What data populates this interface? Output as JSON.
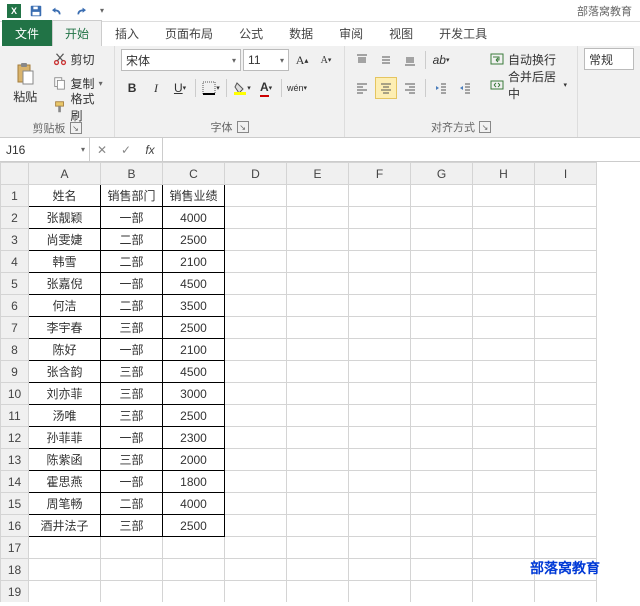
{
  "titlebar": {
    "doc_title": "部落窝教育"
  },
  "tabs": {
    "file": "文件",
    "items": [
      "开始",
      "插入",
      "页面布局",
      "公式",
      "数据",
      "审阅",
      "视图",
      "开发工具"
    ],
    "active": 0
  },
  "ribbon": {
    "clipboard": {
      "label": "剪贴板",
      "paste": "粘贴",
      "cut": "剪切",
      "copy": "复制",
      "painter": "格式刷"
    },
    "font": {
      "label": "字体",
      "family": "宋体",
      "size": "11",
      "ruby": "wén"
    },
    "alignment": {
      "label": "对齐方式",
      "wrap": "自动换行",
      "merge": "合并后居中"
    },
    "number": {
      "label": "常规"
    }
  },
  "formula_bar": {
    "cell_ref": "J16",
    "fx": "fx",
    "value": ""
  },
  "watermark": "部落窝教育",
  "columns": [
    "A",
    "B",
    "C",
    "D",
    "E",
    "F",
    "G",
    "H",
    "I"
  ],
  "headers": [
    "姓名",
    "销售部门",
    "销售业绩"
  ],
  "rows": [
    [
      "张靓颖",
      "一部",
      "4000"
    ],
    [
      "尚雯婕",
      "二部",
      "2500"
    ],
    [
      "韩雪",
      "二部",
      "2100"
    ],
    [
      "张嘉倪",
      "一部",
      "4500"
    ],
    [
      "何洁",
      "二部",
      "3500"
    ],
    [
      "李宇春",
      "三部",
      "2500"
    ],
    [
      "陈好",
      "一部",
      "2100"
    ],
    [
      "张含韵",
      "三部",
      "4500"
    ],
    [
      "刘亦菲",
      "三部",
      "3000"
    ],
    [
      "汤唯",
      "三部",
      "2500"
    ],
    [
      "孙菲菲",
      "一部",
      "2300"
    ],
    [
      "陈紫函",
      "三部",
      "2000"
    ],
    [
      "霍思燕",
      "一部",
      "1800"
    ],
    [
      "周笔畅",
      "二部",
      "4000"
    ],
    [
      "酒井法子",
      "三部",
      "2500"
    ]
  ],
  "chart_data": {
    "type": "table",
    "title": "",
    "columns": [
      "姓名",
      "销售部门",
      "销售业绩"
    ],
    "rows": [
      [
        "张靓颖",
        "一部",
        4000
      ],
      [
        "尚雯婕",
        "二部",
        2500
      ],
      [
        "韩雪",
        "二部",
        2100
      ],
      [
        "张嘉倪",
        "一部",
        4500
      ],
      [
        "何洁",
        "二部",
        3500
      ],
      [
        "李宇春",
        "三部",
        2500
      ],
      [
        "陈好",
        "一部",
        2100
      ],
      [
        "张含韵",
        "三部",
        4500
      ],
      [
        "刘亦菲",
        "三部",
        3000
      ],
      [
        "汤唯",
        "三部",
        2500
      ],
      [
        "孙菲菲",
        "一部",
        2300
      ],
      [
        "陈紫函",
        "三部",
        2000
      ],
      [
        "霍思燕",
        "一部",
        1800
      ],
      [
        "周笔畅",
        "二部",
        4000
      ],
      [
        "酒井法子",
        "三部",
        2500
      ]
    ]
  }
}
